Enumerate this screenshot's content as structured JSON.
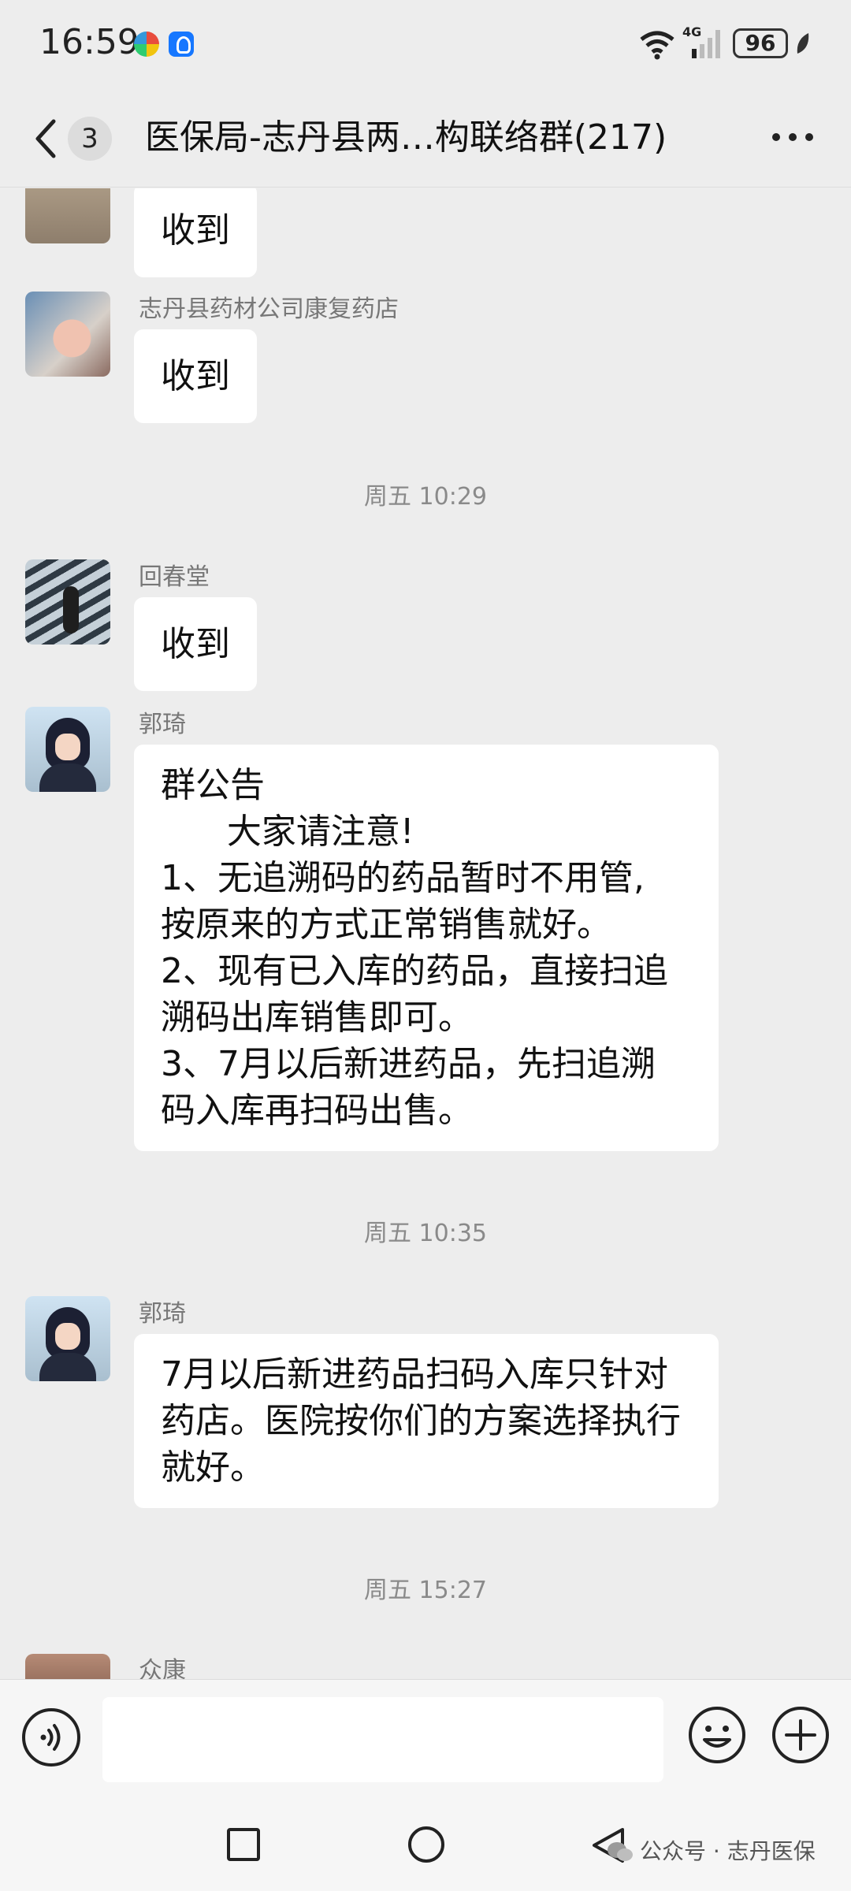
{
  "status_bar": {
    "time": "16:59",
    "network": "4G",
    "battery": "96"
  },
  "header": {
    "back_count": "3",
    "title": "医保局-志丹县两…构联络群(217)"
  },
  "messages": [
    {
      "sender": "",
      "lines": [
        "收到"
      ]
    },
    {
      "sender": "志丹县药材公司康复药店",
      "lines": [
        "收到"
      ]
    },
    {
      "time": "周五 10:29"
    },
    {
      "sender": "回春堂",
      "lines": [
        "收到"
      ]
    },
    {
      "sender": "郭琦",
      "lines": [
        "群公告",
        "      大家请注意!",
        "1、无追溯码的药品暂时不用管,",
        "按原来的方式正常销售就好。",
        "2、现有已入库的药品，直接扫追",
        "溯码出库销售即可。",
        "3、7月以后新进药品，先扫追溯",
        "码入库再扫码出售。"
      ]
    },
    {
      "time": "周五 10:35"
    },
    {
      "sender": "郭琦",
      "lines": [
        "7月以后新进药品扫码入库只针对",
        "药店。医院按你们的方案选择执行",
        "就好。"
      ]
    },
    {
      "time": "周五 15:27"
    },
    {
      "sender": "众康",
      "lines": []
    }
  ],
  "input": {
    "placeholder": ""
  },
  "watermark": "公众号 · 志丹医保",
  "colors": {
    "background": "#ededed",
    "bubble": "#ffffff",
    "meta_text": "#8a8a8a"
  }
}
